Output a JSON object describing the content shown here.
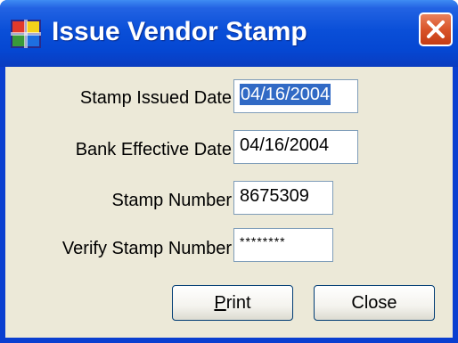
{
  "window": {
    "title": "Issue Vendor Stamp",
    "icon": "app-window-icon",
    "close_icon": "close-icon"
  },
  "form": {
    "stamp_issued_date": {
      "label": "Stamp Issued Date",
      "value": "04/16/2004"
    },
    "bank_effective_date": {
      "label": "Bank Effective Date",
      "value": "04/16/2004"
    },
    "stamp_number": {
      "label": "Stamp Number",
      "value": "8675309"
    },
    "verify_stamp_number": {
      "label": "Verify Stamp Number",
      "value": "********"
    }
  },
  "buttons": {
    "print": {
      "accel": "P",
      "rest": "rint"
    },
    "close": {
      "label": "Close"
    }
  },
  "colors": {
    "titlebar": "#0a4fd8",
    "client_background": "#ece9d8",
    "selection": "#316ac5",
    "close_button": "#d9542a"
  }
}
